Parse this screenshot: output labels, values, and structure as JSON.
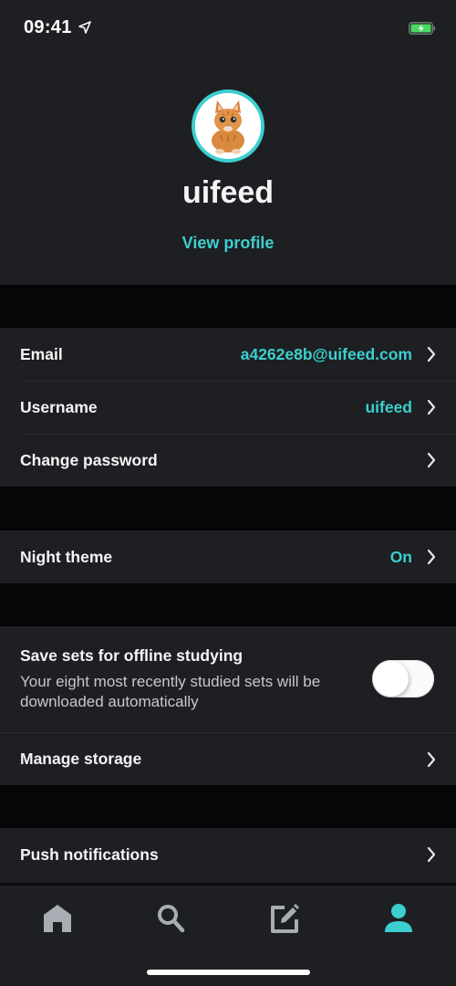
{
  "status_bar": {
    "time": "09:41",
    "location_icon": "location-arrow-icon",
    "battery_icon": "battery-charging-icon",
    "battery_color": "#4cd964"
  },
  "profile": {
    "avatar_icon": "kitten-avatar",
    "username": "uifeed",
    "view_profile_label": "View profile"
  },
  "account_group": {
    "rows": [
      {
        "label": "Email",
        "value": "a4262e8b@uifeed.com"
      },
      {
        "label": "Username",
        "value": "uifeed"
      },
      {
        "label": "Change password",
        "value": ""
      }
    ]
  },
  "appearance_group": {
    "rows": [
      {
        "label": "Night theme",
        "value": "On"
      }
    ]
  },
  "offline_group": {
    "toggle": {
      "title": "Save sets for offline studying",
      "description": "Your eight most recently studied sets will be downloaded automatically",
      "enabled": false
    },
    "rows": [
      {
        "label": "Manage storage",
        "value": ""
      }
    ]
  },
  "notifications_group": {
    "rows": [
      {
        "label": "Push notifications",
        "value": ""
      }
    ]
  },
  "tab_bar": {
    "tabs": [
      {
        "icon": "home-icon",
        "active": false
      },
      {
        "icon": "search-icon",
        "active": false
      },
      {
        "icon": "create-icon",
        "active": false
      },
      {
        "icon": "profile-icon",
        "active": true
      }
    ],
    "active_color": "#3ccfcf",
    "inactive_color": "#a8adb4"
  },
  "colors": {
    "accent": "#3ccfcf",
    "background": "#1d1f22",
    "separator_band": "#050607"
  }
}
